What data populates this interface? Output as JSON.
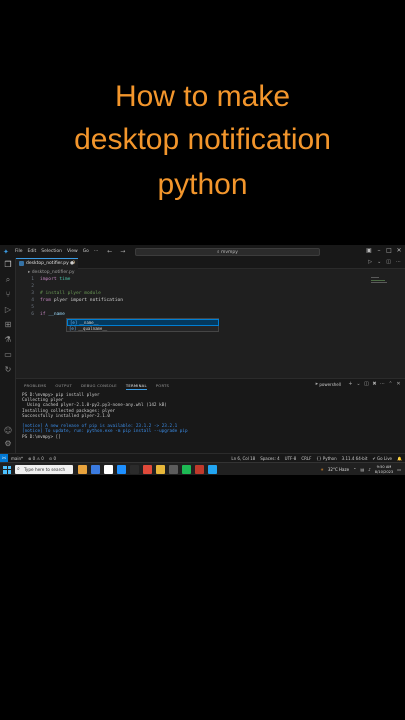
{
  "headline": {
    "line1": "How to make",
    "line2": "desktop notification",
    "line3": "python"
  },
  "titlebar": {
    "menus": [
      "File",
      "Edit",
      "Selection",
      "View",
      "Go",
      "···"
    ],
    "search": "⌕ mvmpy"
  },
  "tab": {
    "filename": "desktop_notifier.py",
    "status": "9",
    "close_glyph": "●"
  },
  "breadcrumb": "▸ desktop_notifier.py",
  "editor": {
    "lines": [
      {
        "n": "1",
        "kw": "import",
        "rest": " time"
      },
      {
        "n": "2",
        "kw": "",
        "rest": ""
      },
      {
        "n": "3",
        "kw": "",
        "rest": "# install plyer module"
      },
      {
        "n": "4",
        "kw": "from",
        "rest": " plyer import notification"
      },
      {
        "n": "5",
        "kw": "",
        "rest": ""
      },
      {
        "n": "6",
        "kw": "if",
        "rest": " __name"
      }
    ],
    "suggestions": [
      {
        "kind": "[e]",
        "label": "__name__"
      },
      {
        "kind": "[e]",
        "label": "__qualname__"
      }
    ]
  },
  "panel": {
    "tabs": [
      "PROBLEMS",
      "OUTPUT",
      "DEBUG CONSOLE",
      "TERMINAL",
      "PORTS"
    ],
    "active_tab": "TERMINAL",
    "shell": "powershell",
    "terminal": [
      "PS D:\\mvmpy> pip install plyer",
      "Collecting plyer",
      "  Using cached plyer-2.1.0-py2.py3-none-any.whl (142 kB)",
      "Installing collected packages: plyer",
      "Successfully installed plyer-2.1.0",
      "",
      "[notice] A new release of pip is available: 23.1.2 -> 23.2.1",
      "[notice] To update, run: python.exe -m pip install --upgrade pip",
      "PS D:\\mvmpy> []"
    ]
  },
  "statusbar": {
    "left": [
      "main*",
      "⊗ 0 ⚠ 0",
      "⊙ 0"
    ],
    "right": [
      "Ln 6, Col 18",
      "Spaces: 4",
      "UTF-8",
      "CRLF",
      "{} Python",
      "3.11.4 64-bit",
      "✔ Go Live",
      "🔔"
    ]
  },
  "taskbar": {
    "search_placeholder": "Type here to search",
    "weather": "32°C Haze",
    "time": "9:50 AM",
    "date": "8/10/2023",
    "pinned_colors": [
      "#e8a33d",
      "#3b7be0",
      "#ffffff",
      "#1e90ff",
      "#2b2b2b",
      "#e04a3a",
      "#e7b73a",
      "#5c5c5c",
      "#1db954",
      "#c0392b",
      "#22a5f1"
    ]
  }
}
